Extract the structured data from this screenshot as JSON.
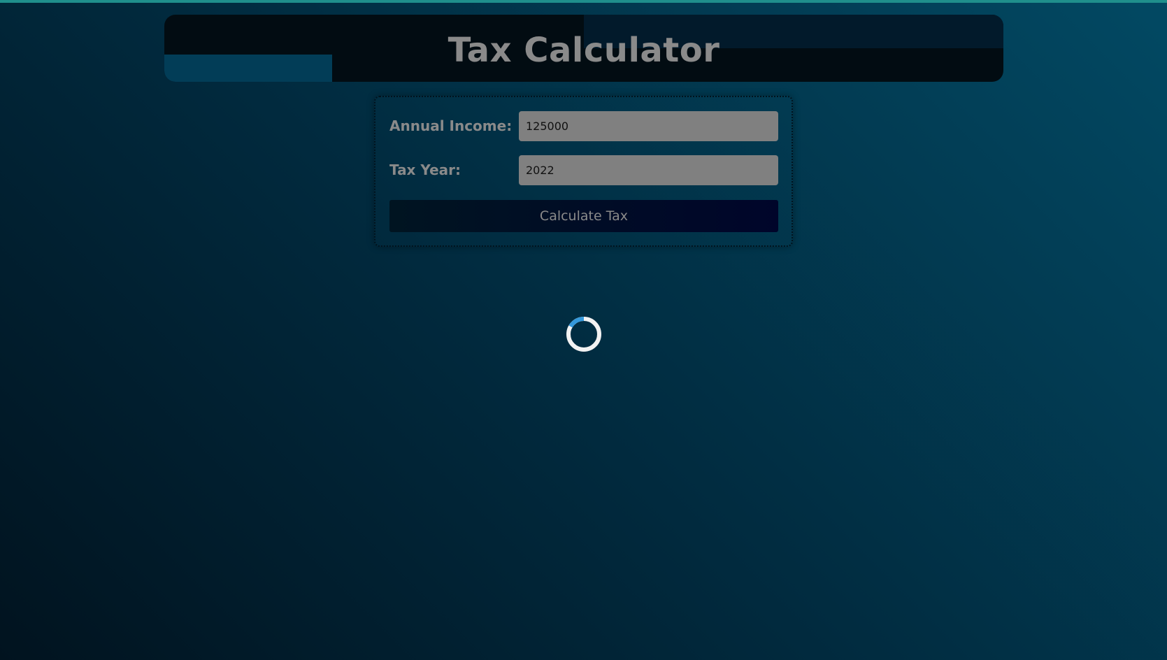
{
  "header": {
    "title": "Tax Calculator"
  },
  "form": {
    "income_label": "Annual Income:",
    "income_value": "125000",
    "year_label": "Tax Year:",
    "year_value": "2022",
    "submit_label": "Calculate Tax"
  },
  "status": {
    "spinner_icon": "loading-spinner-icon"
  },
  "colors": {
    "background_dark": "#01131f",
    "background_light": "#024963",
    "header_bg": "#020c12",
    "text_gray": "#8a8a8a",
    "input_bg": "#808080",
    "button_bg": "#001421",
    "spinner_accent": "#3498db",
    "spinner_track": "#f2f2f2"
  }
}
